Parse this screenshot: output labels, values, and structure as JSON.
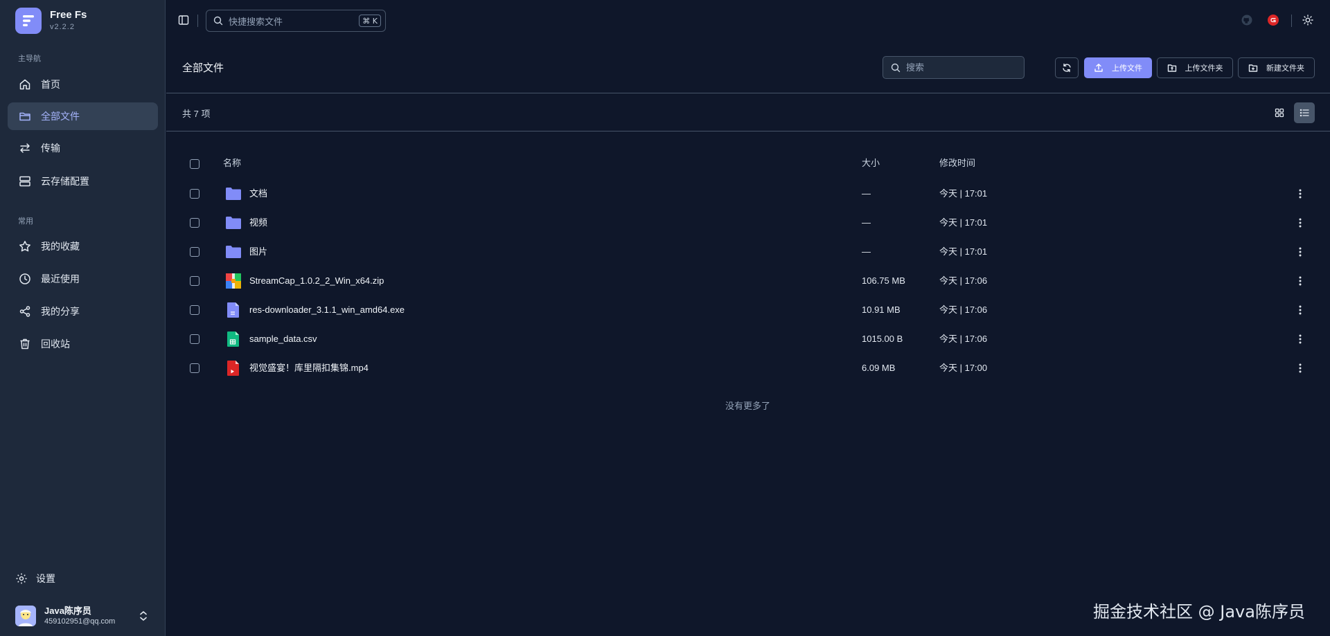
{
  "app": {
    "name": "Free Fs",
    "version": "v2.2.2"
  },
  "sidebar": {
    "group_main": "主导航",
    "main_items": [
      {
        "label": "首页",
        "icon": "home-icon"
      },
      {
        "label": "全部文件",
        "icon": "folder-icon",
        "active": true
      },
      {
        "label": "传输",
        "icon": "transfer-icon"
      },
      {
        "label": "云存储配置",
        "icon": "server-icon"
      }
    ],
    "group_common": "常用",
    "common_items": [
      {
        "label": "我的收藏",
        "icon": "star-icon"
      },
      {
        "label": "最近使用",
        "icon": "clock-icon"
      },
      {
        "label": "我的分享",
        "icon": "share-icon"
      },
      {
        "label": "回收站",
        "icon": "trash-icon"
      }
    ],
    "settings_label": "设置",
    "user": {
      "name": "Java陈序员",
      "email": "459102951@qq.com"
    }
  },
  "topbar": {
    "search_placeholder": "快捷搜索文件",
    "shortcut": "⌘ K"
  },
  "header": {
    "title": "全部文件",
    "search_placeholder": "搜索",
    "upload_file": "上传文件",
    "upload_folder": "上传文件夹",
    "new_folder": "新建文件夹"
  },
  "summary": {
    "count_text": "共 7 项"
  },
  "table": {
    "columns": {
      "name": "名称",
      "size": "大小",
      "modified": "修改时间"
    },
    "rows": [
      {
        "name": "文档",
        "size": "—",
        "modified": "今天 | 17:01",
        "type": "folder"
      },
      {
        "name": "视频",
        "size": "—",
        "modified": "今天 | 17:01",
        "type": "folder"
      },
      {
        "name": "图片",
        "size": "—",
        "modified": "今天 | 17:01",
        "type": "folder"
      },
      {
        "name": "StreamCap_1.0.2_2_Win_x64.zip",
        "size": "106.75 MB",
        "modified": "今天 | 17:06",
        "type": "zip"
      },
      {
        "name": "res-downloader_3.1.1_win_amd64.exe",
        "size": "10.91 MB",
        "modified": "今天 | 17:06",
        "type": "exe"
      },
      {
        "name": "sample_data.csv",
        "size": "1015.00 B",
        "modified": "今天 | 17:06",
        "type": "csv"
      },
      {
        "name": "视觉盛宴！库里隔扣集锦.mp4",
        "size": "6.09 MB",
        "modified": "今天 | 17:00",
        "type": "mp4"
      }
    ],
    "end_text": "没有更多了"
  },
  "watermark": "掘金技术社区 @ Java陈序员",
  "colors": {
    "background": "#0f172a",
    "sidebar": "#1e293b",
    "accent": "#818cf8",
    "folder": "#818cf8"
  }
}
